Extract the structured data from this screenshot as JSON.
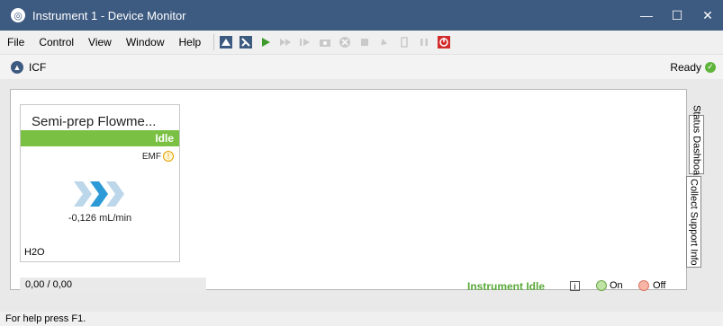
{
  "window": {
    "title": "Instrument 1 - Device Monitor",
    "buttons": {
      "minimize": "—",
      "maximize": "☐",
      "close": "✕"
    }
  },
  "menu": [
    "File",
    "Control",
    "View",
    "Window",
    "Help"
  ],
  "toolbar": {
    "icons": [
      "connect-icon",
      "wizard-icon",
      "play-icon",
      "fast-forward-icon",
      "step-icon",
      "camera-icon",
      "stop-circle-icon",
      "stop-icon",
      "refresh-icon",
      "valve-icon",
      "pause-icon",
      "power-icon"
    ]
  },
  "icf": {
    "label": "ICF",
    "status": "Ready"
  },
  "device": {
    "title": "Semi-prep Flowme...",
    "status": "Idle",
    "emf": "EMF",
    "emf_warning": "!",
    "flow": "-0,126 mL/min",
    "fluid": "H2O"
  },
  "panel_status": {
    "values": "0,00 / 0,00",
    "instrument_state": "Instrument Idle",
    "info": "i",
    "on_label": "On",
    "off_label": "Off"
  },
  "tabs": [
    "Status Dashboard",
    "Collect Support Info"
  ],
  "footer": {
    "help": "For help press F1."
  },
  "colors": {
    "title_bar": "#3d5a80",
    "idle_green": "#79c043",
    "ready_green": "#5fb53b"
  }
}
